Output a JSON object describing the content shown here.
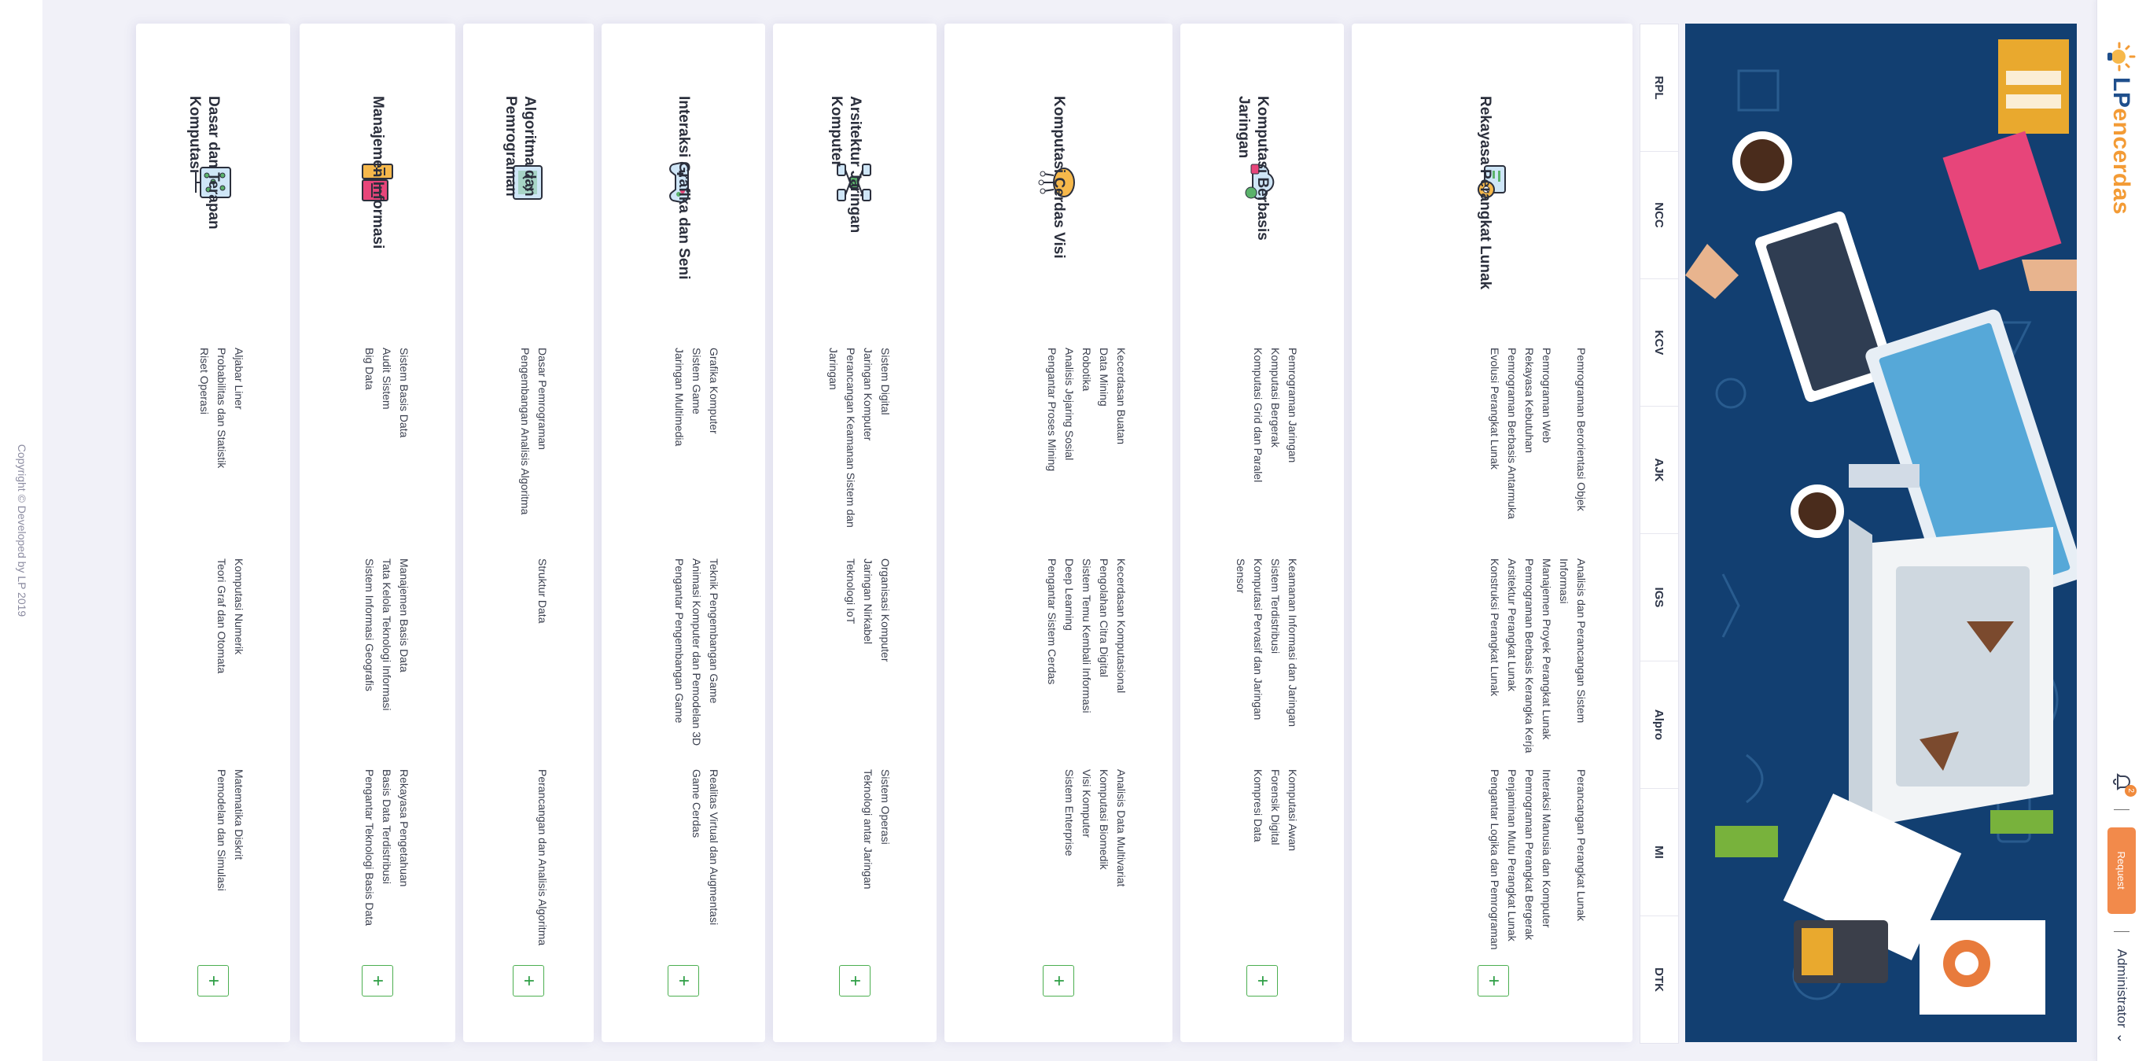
{
  "brand": {
    "lp": "LP",
    "rest": "encerdas"
  },
  "navbar": {
    "notification_count": "2",
    "request_label": "Request",
    "user_label": "Administrator",
    "user_caret": "⌄"
  },
  "tabs": [
    "RPL",
    "NCC",
    "KCV",
    "AJK",
    "IGS",
    "Alpro",
    "MI",
    "DTK"
  ],
  "copyright": "Copyright © Developed by LP 2019",
  "fields": [
    {
      "title": "Rekayasa Perangkat Lunak",
      "icon": "software-engineering-icon",
      "plus": "+",
      "rows": [
        [
          "Pemrograman Berorientasi Objek",
          "Analisis dan Perancangan Sistem Informasi",
          "Perancangan Perangkat Lunak"
        ],
        [
          "Pemrograman Web",
          "Manajemen Proyek Perangkat Lunak",
          "Interaksi Manusia dan Komputer"
        ],
        [
          "Rekayasa Kebutuhan",
          "Pemrograman Berbasis Kerangka Kerja",
          "Pemrograman Perangkat Bergerak"
        ],
        [
          "Pemrograman Berbasis Antarmuka",
          "Arsitektur Perangkat Lunak",
          "Penjaminan Mutu Perangkat Lunak"
        ],
        [
          "Evolusi Perangkat Lunak",
          "Konstruksi Perangkat Lunak",
          "Pengantar Logika dan Pemrograman"
        ]
      ]
    },
    {
      "title": "Komputasi Berbasis Jaringan",
      "icon": "network-cloud-icon",
      "plus": "+",
      "rows": [
        [
          "Pemrograman Jaringan",
          "Keamanan Informasi dan Jaringan",
          "Komputasi Awan"
        ],
        [
          "Komputasi Bergerak",
          "Sistem Terdistribusi",
          "Forensik Digital"
        ],
        [
          "Komputasi Grid dan Paralel",
          "Komputasi Pervasif dan Jaringan Sensor",
          "Kompresi Data"
        ]
      ]
    },
    {
      "title": "Komputasi Cerdas Visi",
      "icon": "brain-chip-icon",
      "plus": "+",
      "rows": [
        [
          "Kecerdasan Buatan",
          "Kecerdasan Komputasional",
          "Analisis Data Multivariat"
        ],
        [
          "Data Mining",
          "Pengolahan Citra Digital",
          "Komputasi Biomedik"
        ],
        [
          "Robotika",
          "Sistem Temu Kembali Informasi",
          "Visi Komputer"
        ],
        [
          "Analisis Jejaring Sosial",
          "Deep Learning",
          "Sistem Enterprise"
        ],
        [
          "Pengantar Proses Mining",
          "Pengantar Sistem Cerdas",
          ""
        ]
      ]
    },
    {
      "title": "Arsitektur Jaringan Komputer",
      "icon": "network-topology-icon",
      "plus": "+",
      "rows": [
        [
          "Sistem Digital",
          "Organisasi Komputer",
          "Sistem Operasi"
        ],
        [
          "Jaringan Komputer",
          "Jaringan Nirkabel",
          "Teknologi antar Jaringan"
        ],
        [
          "Perancangan Keamanan Sistem dan Jaringan",
          "Teknologi IoT",
          ""
        ]
      ]
    },
    {
      "title": "Interaksi Grafika dan Seni",
      "icon": "gamepad-icon",
      "plus": "+",
      "rows": [
        [
          "Grafika Komputer",
          "Teknik Pengembangan Game",
          "Realitas Virtual dan Augmentasi"
        ],
        [
          "Sistem Game",
          "Animasi Komputer dan Pemodelan 3D",
          "Game Cerdas"
        ],
        [
          "Jaringan Multimedia",
          "Pengantar Pengembangan Game",
          ""
        ]
      ]
    },
    {
      "title": "Algoritma dan Pemrograman",
      "icon": "code-screen-icon",
      "plus": "+",
      "rows": [
        [
          "Dasar Pemrograman",
          "Struktur Data",
          "Perancangan dan Analisis Algoritma"
        ],
        [
          "Pengembangan Analisis Algoritma",
          "",
          ""
        ]
      ]
    },
    {
      "title": "Manajemen Informasi",
      "icon": "database-servers-icon",
      "plus": "+",
      "rows": [
        [
          "Sistem Basis Data",
          "Manajemen Basis Data",
          "Rekayasa Pengetahuan"
        ],
        [
          "Audit Sistem",
          "Tata Kelola Teknologi Informasi",
          "Basis Data Terdistribusi"
        ],
        [
          "Big Data",
          "Sistem Informasi Geografis",
          "Pengantar Teknologi Basis Data"
        ]
      ]
    },
    {
      "title": "Dasar dan Terapan Komputasi",
      "icon": "circuit-board-icon",
      "plus": "+",
      "rows": [
        [
          "Aljabar Liner",
          "Komputasi Numerik",
          "Matematika Diskrit"
        ],
        [
          "Probabilitas dan Statistik",
          "Teori Graf dan Otomata",
          "Pemodelan dan Simulasi"
        ],
        [
          "Riset Operasi",
          "",
          ""
        ]
      ]
    }
  ]
}
